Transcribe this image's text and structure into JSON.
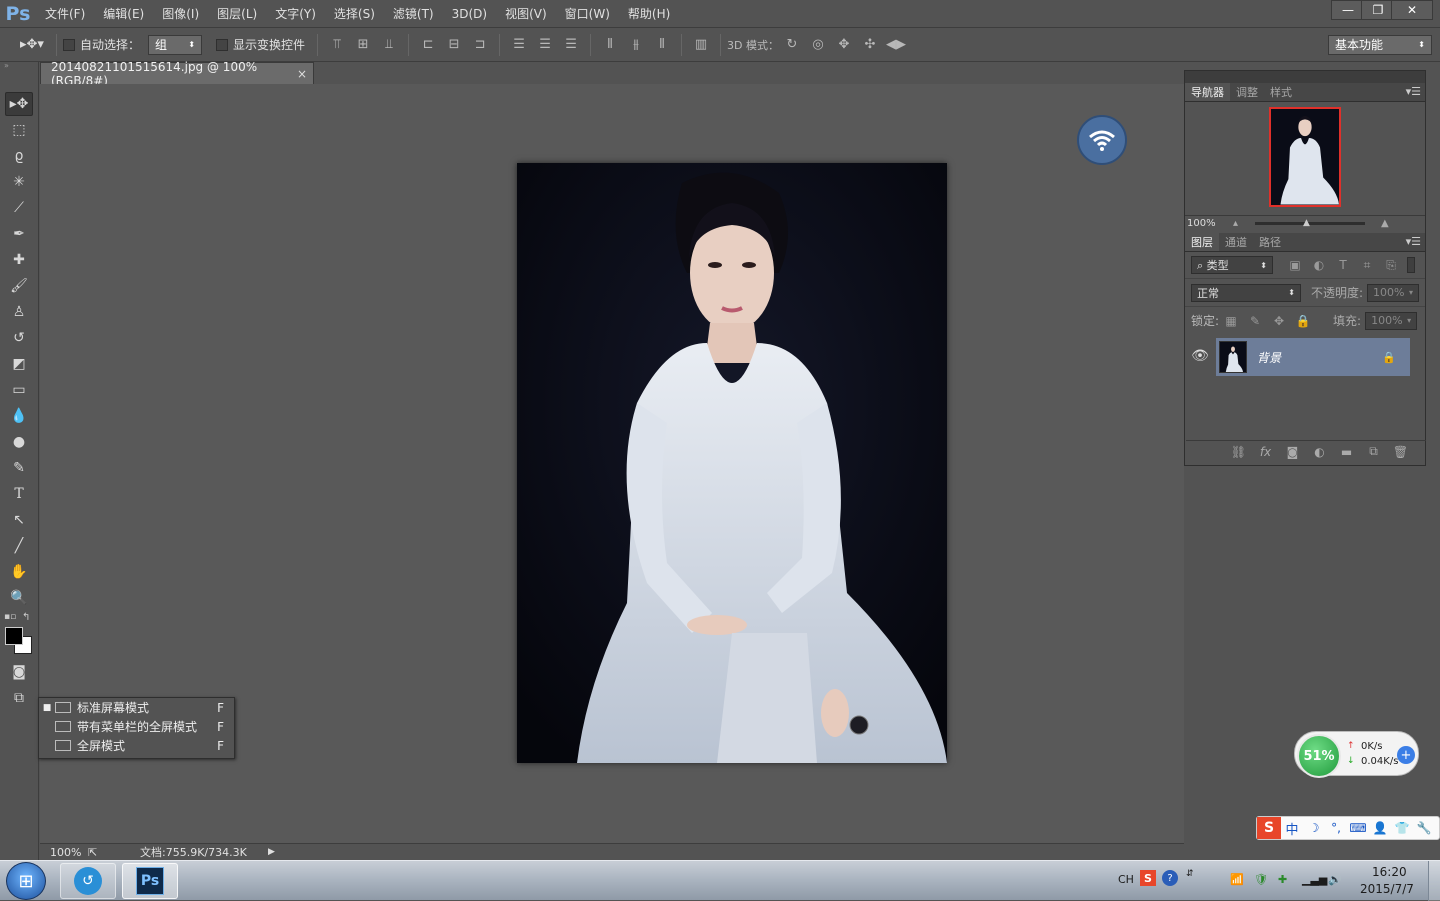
{
  "app": {
    "logo": "Ps",
    "accent": "#7fb3e8"
  },
  "menu": [
    "文件(F)",
    "编辑(E)",
    "图像(I)",
    "图层(L)",
    "文字(Y)",
    "选择(S)",
    "滤镜(T)",
    "3D(D)",
    "视图(V)",
    "窗口(W)",
    "帮助(H)"
  ],
  "window_controls": {
    "minimize": "—",
    "restore": "❐",
    "close": "✕"
  },
  "options": {
    "auto_select_label": "自动选择：",
    "auto_select_value": "组",
    "show_transform_label": "显示变换控件",
    "mode_3d_label": "3D 模式：",
    "workspace": "基本功能"
  },
  "document": {
    "tab_title": "20140821101515614.jpg @ 100%(RGB/8#)",
    "tab_close": "×"
  },
  "status": {
    "zoom": "100%",
    "doc_info": "文档:755.9K/734.3K",
    "arrow": "▶"
  },
  "screen_mode_menu": [
    {
      "label": "标准屏幕模式",
      "key": "F",
      "selected": true
    },
    {
      "label": "带有菜单栏的全屏模式",
      "key": "F",
      "selected": false
    },
    {
      "label": "全屏模式",
      "key": "F",
      "selected": false
    }
  ],
  "navigator": {
    "tabs": [
      "导航器",
      "调整",
      "样式"
    ],
    "zoom": "100%"
  },
  "layers": {
    "tabs": [
      "图层",
      "通道",
      "路径"
    ],
    "filter_type": "类型",
    "blend_mode": "正常",
    "opacity_label": "不透明度:",
    "opacity_value": "100%",
    "lock_label": "锁定:",
    "fill_label": "填充:",
    "fill_value": "100%",
    "items": [
      {
        "name": "背景",
        "locked": true
      }
    ]
  },
  "net_widget": {
    "percent": "51%",
    "up": "0K/s",
    "down": "0.04K/s"
  },
  "ime": {
    "lang": "中"
  },
  "taskbar": {
    "lang_indicator": "CH",
    "time": "16:20",
    "date": "2015/7/7"
  }
}
